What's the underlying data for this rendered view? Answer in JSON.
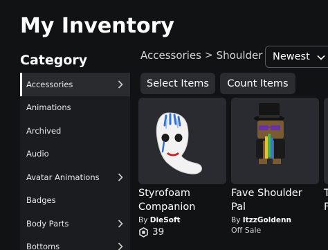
{
  "page": {
    "title": "My Inventory"
  },
  "sidebar": {
    "heading": "Category",
    "items": [
      {
        "label": "Accessories",
        "has_submenu": true,
        "active": true
      },
      {
        "label": "Animations",
        "has_submenu": false
      },
      {
        "label": "Archived",
        "has_submenu": false
      },
      {
        "label": "Audio",
        "has_submenu": false
      },
      {
        "label": "Avatar Animations",
        "has_submenu": true
      },
      {
        "label": "Badges",
        "has_submenu": false
      },
      {
        "label": "Body Parts",
        "has_submenu": true
      },
      {
        "label": "Bottoms",
        "has_submenu": true
      }
    ]
  },
  "breadcrumb": {
    "parent": "Accessories",
    "separator": ">",
    "current": "Shoulder"
  },
  "sort": {
    "selected": "Newest"
  },
  "toolbar": {
    "select_label": "Select Items",
    "count_label": "Count Items"
  },
  "items": [
    {
      "name_line1": "Styrofoam",
      "name_line2": "Companion",
      "by": "By",
      "creator": "DieSoft",
      "price": "39"
    },
    {
      "name_line1": "Fave Shoulder",
      "name_line2": "Pal",
      "by": "By",
      "creator": "ItzzGoldenn",
      "status": "Off Sale"
    },
    {
      "name_line1": "T",
      "name_line2": "F"
    }
  ],
  "colors": {
    "background": "#111214",
    "sidebar": "#1b1c1f",
    "card": "#2a2b30",
    "button": "#2b2c30"
  }
}
